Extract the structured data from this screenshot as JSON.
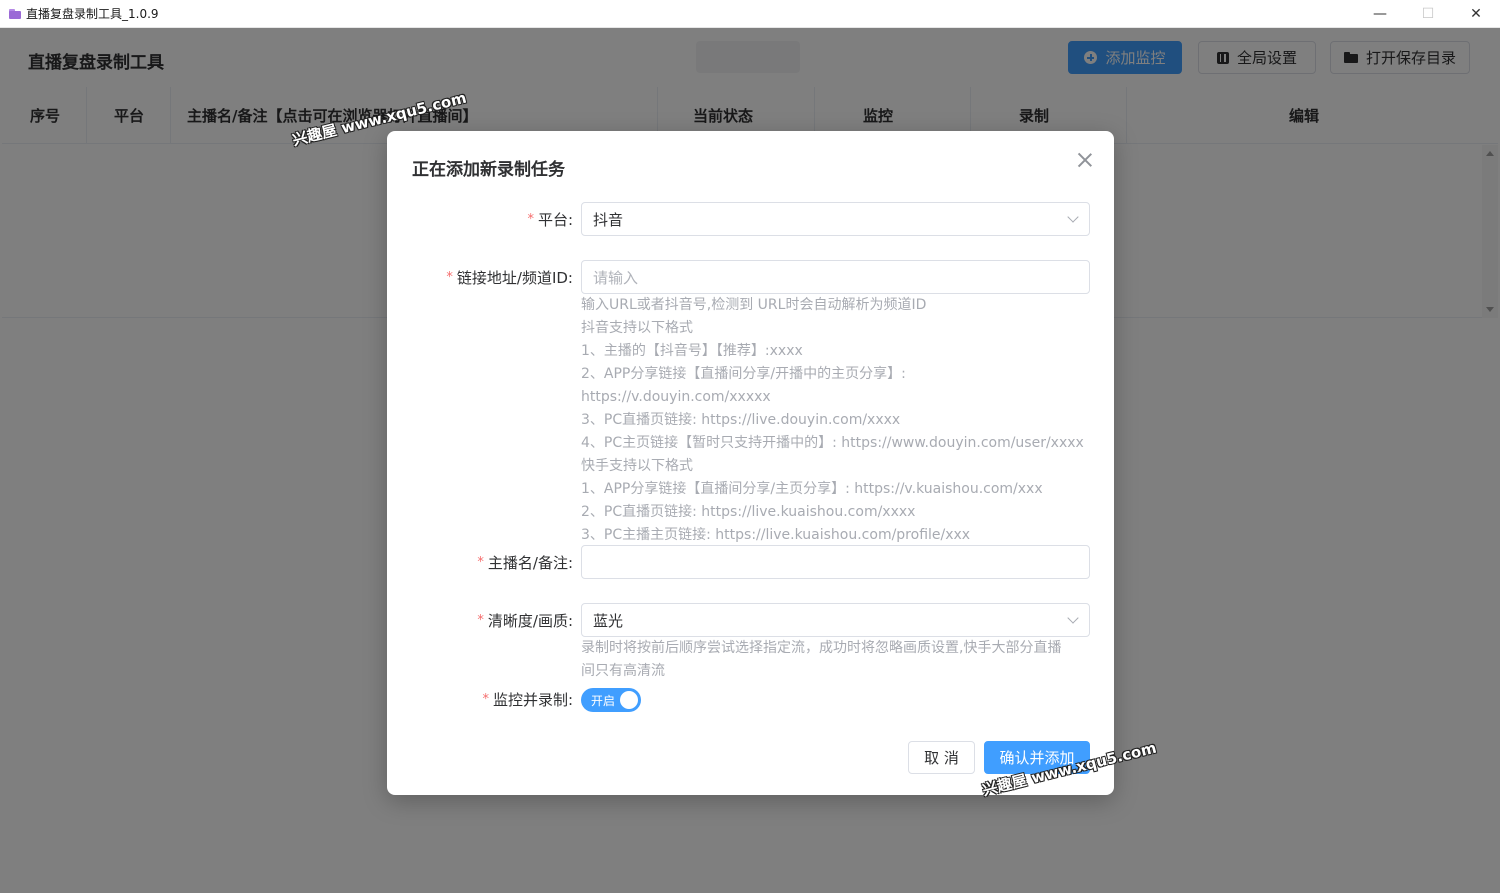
{
  "window": {
    "title": "直播复盘录制工具_1.0.9",
    "minimize": "—",
    "maximize": "☐",
    "close": "✕"
  },
  "header": {
    "title": "直播复盘录制工具",
    "buttons": {
      "add_monitor": "添加监控",
      "global_settings": "全局设置",
      "open_save_dir": "打开保存目录"
    }
  },
  "table": {
    "columns": [
      "序号",
      "平台",
      "主播名/备注【点击可在浏览器打开直播间】",
      "当前状态",
      "监控",
      "录制",
      "编辑"
    ]
  },
  "dialog": {
    "title": "正在添加新录制任务",
    "required_mark": "*",
    "platform": {
      "label": "平台:",
      "value": "抖音"
    },
    "link": {
      "label": "链接地址/频道ID:",
      "placeholder": "请输入",
      "help": [
        "输入URL或者抖音号,检测到 URL时会自动解析为频道ID",
        "抖音支持以下格式",
        "1、主播的【抖音号】【推荐】:xxxx",
        "2、APP分享链接【直播间分享/开播中的主页分享】:",
        "https://v.douyin.com/xxxxx",
        "3、PC直播页链接: https://live.douyin.com/xxxx",
        "4、PC主页链接【暂时只支持开播中的】: https://www.douyin.com/user/xxxx",
        "快手支持以下格式",
        "1、APP分享链接【直播间分享/主页分享】: https://v.kuaishou.com/xxx",
        "2、PC直播页链接: https://live.kuaishou.com/xxxx",
        "3、PC主播主页链接: https://live.kuaishou.com/profile/xxx"
      ]
    },
    "anchor": {
      "label": "主播名/备注:",
      "value": ""
    },
    "quality": {
      "label": "清晰度/画质:",
      "value": "蓝光",
      "help": [
        "录制时将按前后顺序尝试选择指定流，成功时将忽略画质设置,快手大部分直播",
        "间只有高清流"
      ]
    },
    "monitor_record": {
      "label": "监控并录制:",
      "switch_text": "开启",
      "enabled": true
    },
    "buttons": {
      "cancel": "取 消",
      "confirm": "确认并添加"
    }
  },
  "watermarks": [
    "兴趣屋 www.xqu5.com",
    "兴趣屋 www.xqu5.com"
  ],
  "colors": {
    "primary": "#409eff",
    "required": "#f56c6c",
    "overlay": "rgba(0,0,0,0.5)"
  }
}
